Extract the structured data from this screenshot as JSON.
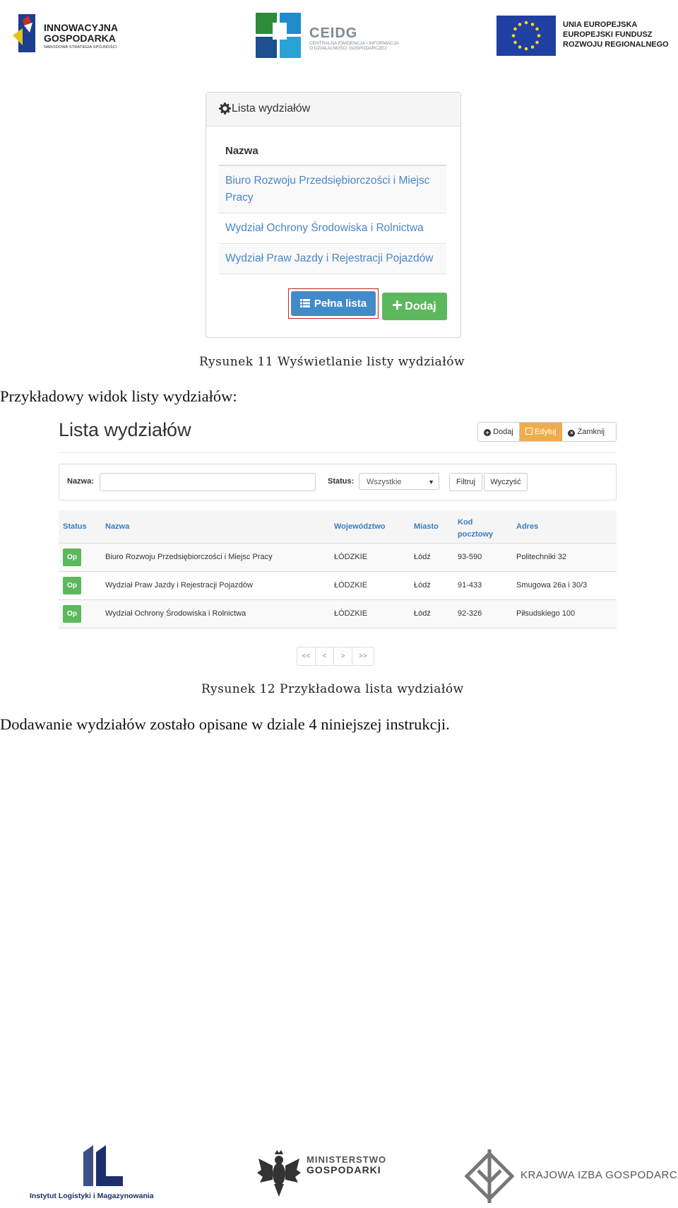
{
  "header": {
    "logo_left": {
      "title": "INNOWACYJNA GOSPODARKA",
      "subtitle": "NARODOWA STRATEGIA SPÓJNOŚCI"
    },
    "logo_center": {
      "title": "CEIDG",
      "subtitle": "CENTRALNA EWIDENCJA I INFORMACJA O DZIAŁALNOŚCI GOSPODARCZEJ"
    },
    "logo_right": {
      "line1": "UNIA EUROPEJSKA",
      "line2": "EUROPEJSKI FUNDUSZ",
      "line3": "ROZWOJU REGIONALNEGO"
    }
  },
  "figure11": {
    "panel_title": "Lista wydziałów",
    "column_header": "Nazwa",
    "rows": [
      "Biuro Rozwoju Przedsiębiorczości i Miejsc Pracy",
      "Wydział Ochrony Środowiska i Rolnictwa",
      "Wydział Praw Jazdy i Rejestracji Pojazdów"
    ],
    "btn_full_list": "Pełna lista",
    "btn_add": "Dodaj",
    "caption": "Rysunek 11 Wyświetlanie listy wydziałów"
  },
  "text_intro": "Przykładowy widok listy wydziałów:",
  "figure12": {
    "title": "Lista wydziałów",
    "toolbar": {
      "add": "Dodaj",
      "edit": "Edytuj",
      "close": "Zamknij"
    },
    "filter": {
      "name_label": "Nazwa:",
      "name_value": "",
      "status_label": "Status:",
      "status_value": "Wszystkie",
      "filter_btn": "Filtruj",
      "clear_btn": "Wyczyść"
    },
    "columns": [
      "Status",
      "Nazwa",
      "Województwo",
      "Miasto",
      "Kod pocztowy",
      "Adres"
    ],
    "rows": [
      {
        "status": "Op",
        "name": "Biuro Rozwoju Przedsiębiorczości i Miejsc Pracy",
        "voivodeship": "ŁÓDZKIE",
        "city": "Łódź",
        "postal": "93-590",
        "address": "Politechniki 32"
      },
      {
        "status": "Op",
        "name": "Wydział Praw Jazdy i Rejestracji Pojazdów",
        "voivodeship": "ŁÓDZKIE",
        "city": "Łódź",
        "postal": "91-433",
        "address": "Smugowa 26a i 30/3"
      },
      {
        "status": "Op",
        "name": "Wydział Ochrony Środowiska i Rolnictwa",
        "voivodeship": "ŁÓDZKIE",
        "city": "Łódź",
        "postal": "92-326",
        "address": "Piłsudskiego 100"
      }
    ],
    "pager": [
      "<<",
      "<",
      ">",
      ">>"
    ],
    "caption": "Rysunek 12 Przykładowa lista wydziałów"
  },
  "text_outro": "Dodawanie wydziałów zostało opisane w dziale 4 niniejszej instrukcji.",
  "footer": {
    "logo_left": "Instytut Logistyki i Magazynowania",
    "logo_center_line1": "MINISTERSTWO",
    "logo_center_line2": "GOSPODARKI",
    "logo_right": "KRAJOWA IZBA GOSPODARCZA"
  },
  "colors": {
    "primary": "#428bca",
    "success": "#5cb85c",
    "warning": "#f0ad4e",
    "highlight": "#c81e1e"
  }
}
